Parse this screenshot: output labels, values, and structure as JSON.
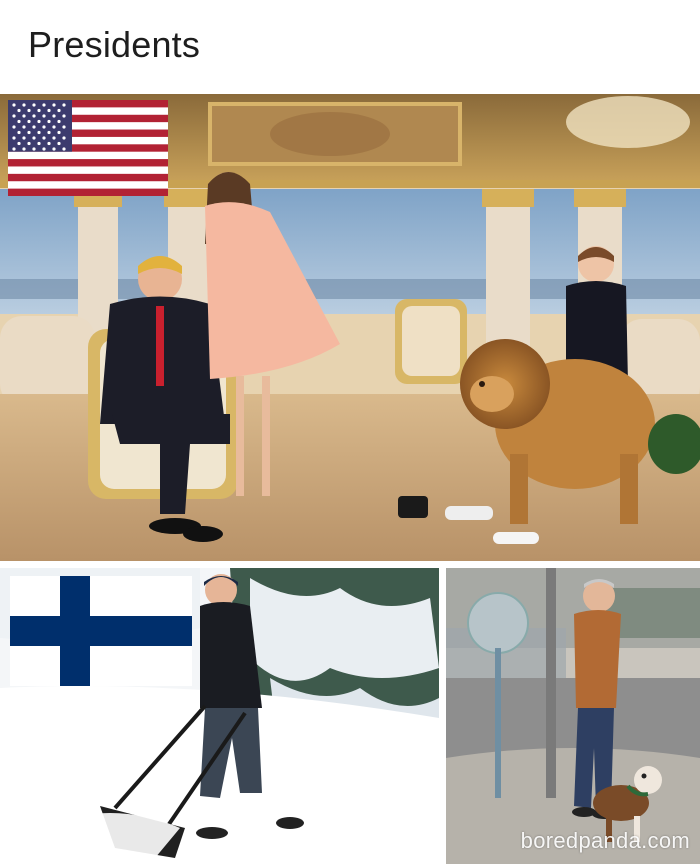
{
  "header": {
    "title": "Presidents"
  },
  "panels": {
    "top": {
      "flag": "us-flag",
      "description": ""
    },
    "bottom_left": {
      "flag": "finland-flag",
      "description": ""
    },
    "bottom_right": {
      "flag": "",
      "description": ""
    }
  },
  "watermark": {
    "text": "boredpanda.com"
  },
  "colors": {
    "us_red": "#b22234",
    "us_blue": "#3c3b6e",
    "fi_blue": "#002f6c"
  }
}
